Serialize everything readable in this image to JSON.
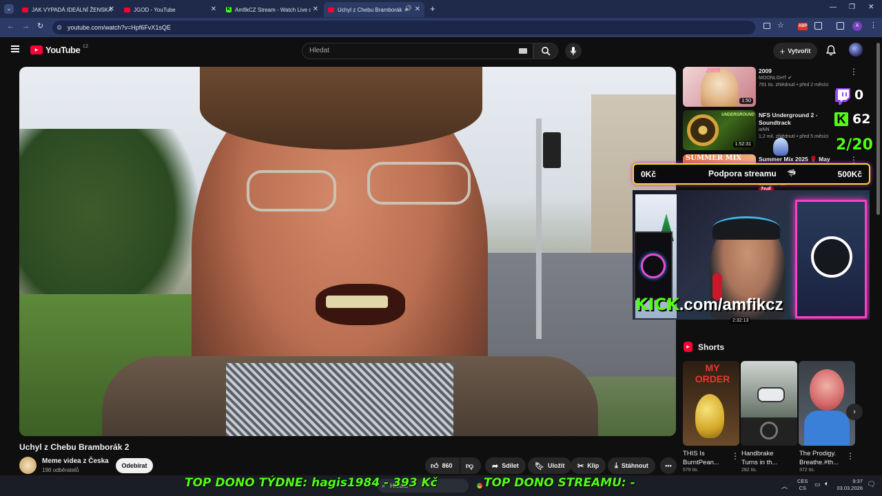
{
  "browser": {
    "tabs": [
      {
        "label": "JAK VYPADÁ IDEÁLNÍ ŽENSKÁ",
        "icon": "youtube-favicon"
      },
      {
        "label": "JGOD - YouTube",
        "icon": "youtube-favicon"
      },
      {
        "label": "AmfikCZ Stream - Watch Live o",
        "icon": "kick-favicon"
      },
      {
        "label": "Uchyl z Chebu Bramborák",
        "icon": "youtube-favicon",
        "active": true
      }
    ],
    "url": "youtube.com/watch?v=Hpf6FvX1sQE"
  },
  "header": {
    "logo": "YouTube",
    "region": "CZ",
    "search_placeholder": "Hledat",
    "create_label": "Vytvořit"
  },
  "video": {
    "title": "Uchyl z Chebu Bramborák 2",
    "channel": "Meme videa z Česka",
    "subscribers": "198 odběratelů",
    "subscribe_label": "Odebírat",
    "likes": "860",
    "share_label": "Sdílet",
    "save_label": "Uložit",
    "clip_label": "Klip",
    "download_label": "Stáhnout"
  },
  "sidebar": {
    "recs": [
      {
        "title": "2009",
        "channel": "MOONLGHT",
        "meta": "791 tis. zhlédnutí • před 2 měsíci",
        "duration": "1:50",
        "verified": true
      },
      {
        "title": "NFS Underground 2 - Soundtrack",
        "channel": "iaNN",
        "meta": "1,2 mil. zhlédnutí • před 5 měsíci",
        "duration": "1:52:31"
      },
      {
        "title": "Summer Mix 2025 🌹 May Top",
        "channel": "",
        "meta": "",
        "duration": ""
      }
    ],
    "partial_meta": "Sledující: 357",
    "partial_badge": "ŽIVĚ",
    "partial_duration": "2:32:13",
    "shorts_heading": "Shorts",
    "shorts": [
      {
        "title": "THIS Is BurntPean...",
        "meta": "579 tis.",
        "thumb_text": "MY ORDER"
      },
      {
        "title": "Handbrake Turns in th...",
        "meta": "282 tis."
      },
      {
        "title": "The Prodigy. Breathe.#th...",
        "meta": "372 tis."
      }
    ]
  },
  "overlay": {
    "twitch_count": "0",
    "kick_count": "62",
    "goal": "2/20",
    "support_left": "0Kč",
    "support_label": "Podpora streamu",
    "support_right": "500Kč",
    "kick_url_prefix": "KICK",
    "kick_url_suffix": ".com/amfikcz",
    "ticker_left": "TOP DONO TÝDNE:  hagis1984 - 393 Kč",
    "ticker_right": "TOP DONO STREAMU: -"
  },
  "taskbar": {
    "search_placeholder": "Hledat",
    "lang_top": "CES",
    "lang_bottom": "CS",
    "time": "9:37",
    "date": "03.03.2026"
  },
  "colors": {
    "youtube_red": "#ff0033",
    "kick_green": "#53fc18",
    "twitch_purple": "#9146ff",
    "overlay_yellow": "#f2e30a"
  }
}
